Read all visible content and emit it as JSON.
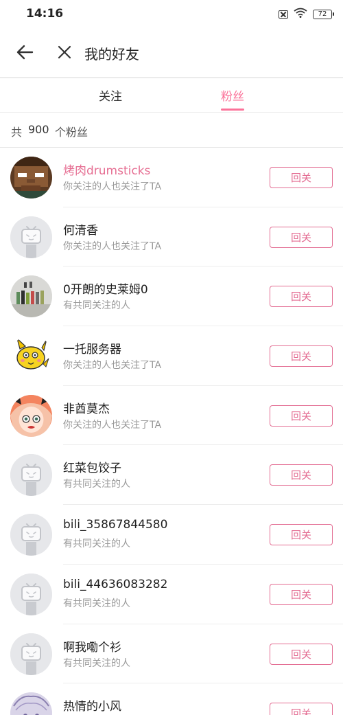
{
  "status_bar": {
    "time": "14:16",
    "battery": "72",
    "icons": [
      "no-sim-icon",
      "wifi-icon",
      "battery-icon"
    ]
  },
  "header": {
    "title": "我的好友",
    "back_icon": "arrow-left-icon",
    "close_icon": "close-icon"
  },
  "tabs": [
    {
      "label": "关注",
      "active": false
    },
    {
      "label": "粉丝",
      "active": true
    }
  ],
  "fans_count": {
    "prefix": "共",
    "count": "900",
    "suffix": "个粉丝"
  },
  "colors": {
    "accent": "#fb7299",
    "button": "#e36c92",
    "vip_name": "#e66f93"
  },
  "fans": [
    {
      "name": "烤肉drumsticks",
      "subtitle": "你关注的人也关注了TA",
      "button": "回关",
      "avatar": "pixel-avatar",
      "vip": true
    },
    {
      "name": "何清香",
      "subtitle": "你关注的人也关注了TA",
      "button": "回关",
      "avatar": "default-tv-avatar",
      "vip": false
    },
    {
      "name": "0开朗的史莱姆0",
      "subtitle": "有共同关注的人",
      "button": "回关",
      "avatar": "figures-photo-avatar",
      "vip": false
    },
    {
      "name": "一托服务器",
      "subtitle": "你关注的人也关注了TA",
      "button": "回关",
      "avatar": "yellow-cartoon-avatar",
      "vip": false
    },
    {
      "name": "非酋莫杰",
      "subtitle": "你关注的人也关注了TA",
      "button": "回关",
      "avatar": "anime-girl-avatar",
      "vip": false
    },
    {
      "name": "红菜包饺子",
      "subtitle": "有共同关注的人",
      "button": "回关",
      "avatar": "default-tv-avatar",
      "vip": false
    },
    {
      "name": "bili_35867844580",
      "subtitle": "有共同关注的人",
      "button": "回关",
      "avatar": "default-tv-avatar",
      "vip": false
    },
    {
      "name": "bili_44636083282",
      "subtitle": "有共同关注的人",
      "button": "回关",
      "avatar": "default-tv-avatar",
      "vip": false
    },
    {
      "name": "啊我嘞个衫",
      "subtitle": "有共同关注的人",
      "button": "回关",
      "avatar": "default-tv-avatar",
      "vip": false
    },
    {
      "name": "热情的小风",
      "subtitle": "",
      "button": "回关",
      "avatar": "anime-sketch-avatar",
      "vip": false
    }
  ]
}
